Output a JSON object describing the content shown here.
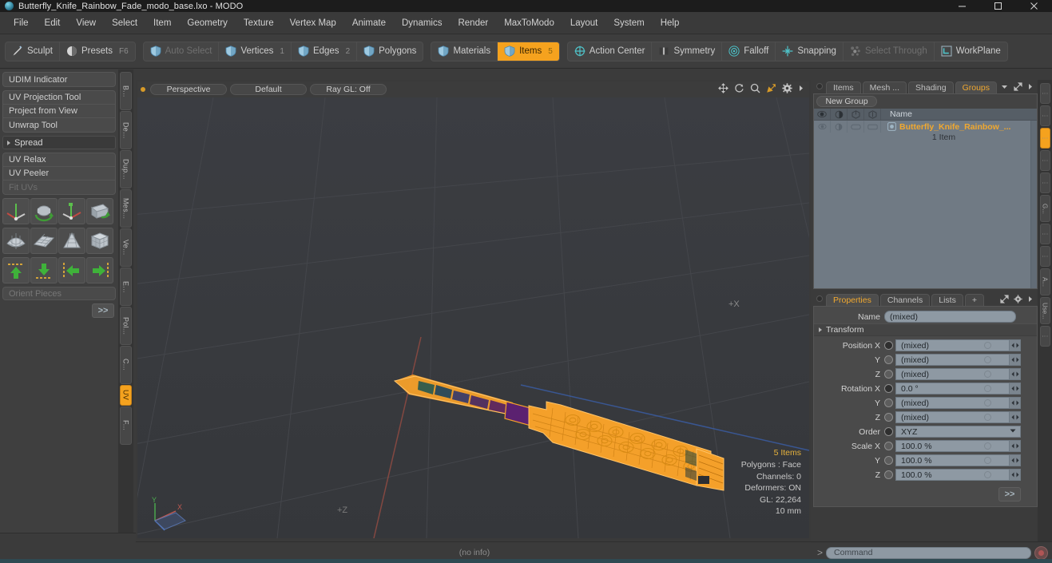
{
  "window": {
    "title": "Butterfly_Knife_Rainbow_Fade_modo_base.lxo - MODO",
    "app_icon": "modo-sphere-icon",
    "minimize": "–",
    "maximize": "□",
    "close": "✕"
  },
  "menubar": {
    "items": [
      "File",
      "Edit",
      "View",
      "Select",
      "Item",
      "Geometry",
      "Texture",
      "Vertex Map",
      "Animate",
      "Dynamics",
      "Render",
      "MaxToModo",
      "Layout",
      "System",
      "Help"
    ]
  },
  "toolbar": {
    "accent": "#f5a21e",
    "groups": [
      {
        "buttons": [
          {
            "label": "Sculpt",
            "icon": "brush-icon",
            "num": "",
            "state": "normal"
          },
          {
            "label": "Presets",
            "icon": "sphere-icon",
            "num": "F6",
            "state": "normal"
          }
        ]
      },
      {
        "buttons": [
          {
            "label": "Auto Select",
            "icon": "shield-icon",
            "num": "",
            "state": "disabled"
          },
          {
            "label": "Vertices",
            "icon": "shield-icon",
            "num": "1",
            "state": "normal"
          },
          {
            "label": "Edges",
            "icon": "shield-icon",
            "num": "2",
            "state": "normal"
          },
          {
            "label": "Polygons",
            "icon": "shield-icon",
            "num": "",
            "state": "normal"
          }
        ]
      },
      {
        "buttons": [
          {
            "label": "Materials",
            "icon": "shield-icon",
            "num": "",
            "state": "normal"
          },
          {
            "label": "Items",
            "icon": "shield-icon",
            "num": "5",
            "state": "active"
          }
        ]
      },
      {
        "buttons": [
          {
            "label": "Action Center",
            "icon": "target-icon",
            "num": "",
            "state": "normal"
          },
          {
            "label": "Symmetry",
            "icon": "symmetry-icon",
            "num": "",
            "state": "normal"
          },
          {
            "label": "Falloff",
            "icon": "falloff-icon",
            "num": "",
            "state": "normal"
          },
          {
            "label": "Snapping",
            "icon": "snap-icon",
            "num": "",
            "state": "normal"
          },
          {
            "label": "Select Through",
            "icon": "select-through-icon",
            "num": "",
            "state": "disabled"
          },
          {
            "label": "WorkPlane",
            "icon": "workplane-icon",
            "num": "",
            "state": "normal"
          }
        ]
      }
    ]
  },
  "left_panel": {
    "udim": "UDIM Indicator",
    "tools_group1": [
      {
        "label": "UV Projection Tool",
        "state": "normal"
      },
      {
        "label": "Project from View",
        "state": "normal"
      },
      {
        "label": "Unwrap Tool",
        "state": "normal"
      }
    ],
    "spread_header": "Spread",
    "tools_group2": [
      {
        "label": "UV Relax",
        "state": "normal"
      },
      {
        "label": "UV Peeler",
        "state": "normal"
      },
      {
        "label": "Fit UVs",
        "state": "disabled"
      }
    ],
    "icon_rows": [
      [
        "uv-gizmo-icon",
        "uv-rotate-icon",
        "uv-move-icon",
        "uv-flip-icon"
      ],
      [
        "uv-sphere-map-icon",
        "uv-grid-flat-icon",
        "uv-cone-map-icon",
        "uv-cube-map-icon"
      ],
      [
        "align-up-icon",
        "align-down-icon",
        "align-left-icon",
        "align-right-icon"
      ]
    ],
    "orient_pieces": "Orient Pieces",
    "more_button": ">>",
    "vertical_tabs": [
      {
        "label": "B...",
        "active": false
      },
      {
        "label": "De...",
        "active": false
      },
      {
        "label": "Dup...",
        "active": false
      },
      {
        "label": "Mes...",
        "active": false
      },
      {
        "label": "Ve...",
        "active": false
      },
      {
        "label": "E...",
        "active": false
      },
      {
        "label": "Pol...",
        "active": false
      },
      {
        "label": "C...",
        "active": false
      },
      {
        "label": "UV",
        "active": true
      },
      {
        "label": "F...",
        "active": false
      }
    ]
  },
  "viewport": {
    "view_mode": "Perspective",
    "shading": "Default",
    "raygl": "Ray GL: Off",
    "tools": [
      "pan-icon",
      "rotate-icon",
      "zoom-icon",
      "fit-icon",
      "gear-icon",
      "chevron-right-icon"
    ],
    "axis_marker": "+X",
    "axis_gizmo": {
      "x": "X",
      "y": "Y",
      "z": "Z"
    },
    "info": {
      "items": "5 Items",
      "polygons": "Polygons : Face",
      "channels": "Channels: 0",
      "deformers": "Deformers: ON",
      "gl": "GL: 22,264",
      "scale": "10 mm"
    },
    "model_color": "#f4a02a",
    "background": "#383a3e"
  },
  "right_panel": {
    "top_tabs": [
      {
        "label": "Items",
        "active": false
      },
      {
        "label": "Mesh ...",
        "active": false
      },
      {
        "label": "Shading",
        "active": false
      },
      {
        "label": "Groups",
        "active": true
      }
    ],
    "top_tab_icons": [
      "chevron-down-icon",
      "expand-icon",
      "chevron-right-icon"
    ],
    "new_group_button": "New Group",
    "list_columns": [
      "eye-icon",
      "shade-icon",
      "wire-icon",
      "lock-icon"
    ],
    "list_name_header": "Name",
    "rows": [
      {
        "name": "Butterfly_Knife_Rainbow_...",
        "sub": "1 Item",
        "icon": "group-icon"
      }
    ],
    "prop_tabs": [
      {
        "label": "Properties",
        "active": true
      },
      {
        "label": "Channels",
        "active": false
      },
      {
        "label": "Lists",
        "active": false
      },
      {
        "label": "+",
        "active": false
      }
    ],
    "prop_tab_icons": [
      "expand-icon",
      "gear-icon",
      "chevron-right-icon"
    ],
    "name_label": "Name",
    "name_value": "(mixed)",
    "transform_header": "Transform",
    "fields": [
      {
        "label": "Position X",
        "value": "(mixed)",
        "filled": true,
        "type": "numeric"
      },
      {
        "label": "Y",
        "value": "(mixed)",
        "filled": false,
        "type": "numeric"
      },
      {
        "label": "Z",
        "value": "(mixed)",
        "filled": false,
        "type": "numeric"
      },
      {
        "label": "Rotation X",
        "value": "0.0 °",
        "filled": true,
        "type": "numeric"
      },
      {
        "label": "Y",
        "value": "(mixed)",
        "filled": false,
        "type": "numeric"
      },
      {
        "label": "Z",
        "value": "(mixed)",
        "filled": false,
        "type": "numeric"
      },
      {
        "label": "Order",
        "value": "XYZ",
        "filled": true,
        "type": "select"
      },
      {
        "label": "Scale X",
        "value": "100.0 %",
        "filled": false,
        "type": "numeric"
      },
      {
        "label": "Y",
        "value": "100.0 %",
        "filled": false,
        "type": "numeric"
      },
      {
        "label": "Z",
        "value": "100.0 %",
        "filled": false,
        "type": "numeric"
      }
    ],
    "more_button": ">>",
    "side_tabs": [
      {
        "label": "",
        "active": false,
        "dots": true
      },
      {
        "label": "",
        "active": false,
        "dots": true
      },
      {
        "label": "",
        "active": true,
        "dots": true
      },
      {
        "label": "",
        "active": false,
        "dots": true
      },
      {
        "label": "",
        "active": false,
        "dots": true
      },
      {
        "label": "G...",
        "active": false,
        "dots": false
      },
      {
        "label": "",
        "active": false,
        "dots": true
      },
      {
        "label": "",
        "active": false,
        "dots": true
      },
      {
        "label": "A...",
        "active": false,
        "dots": false
      },
      {
        "label": "Use...",
        "active": false,
        "dots": false
      },
      {
        "label": "",
        "active": false,
        "dots": true
      }
    ]
  },
  "bottom": {
    "status_text": "(no info)",
    "command_prompt": ">",
    "command_placeholder": "Command",
    "record_icon": "record-icon"
  }
}
